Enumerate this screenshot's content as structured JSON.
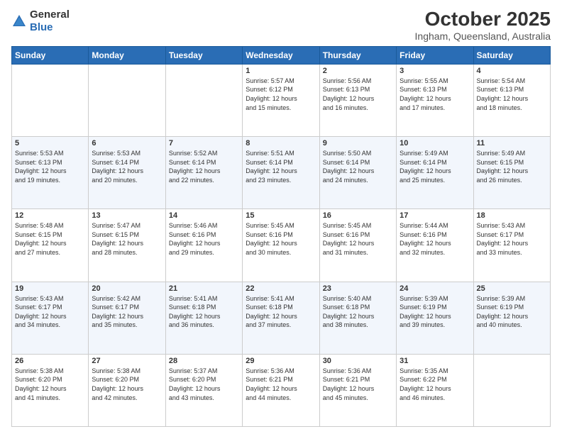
{
  "logo": {
    "general": "General",
    "blue": "Blue"
  },
  "header": {
    "title": "October 2025",
    "subtitle": "Ingham, Queensland, Australia"
  },
  "days_of_week": [
    "Sunday",
    "Monday",
    "Tuesday",
    "Wednesday",
    "Thursday",
    "Friday",
    "Saturday"
  ],
  "weeks": [
    [
      {
        "day": "",
        "info": ""
      },
      {
        "day": "",
        "info": ""
      },
      {
        "day": "",
        "info": ""
      },
      {
        "day": "1",
        "info": "Sunrise: 5:57 AM\nSunset: 6:12 PM\nDaylight: 12 hours\nand 15 minutes."
      },
      {
        "day": "2",
        "info": "Sunrise: 5:56 AM\nSunset: 6:13 PM\nDaylight: 12 hours\nand 16 minutes."
      },
      {
        "day": "3",
        "info": "Sunrise: 5:55 AM\nSunset: 6:13 PM\nDaylight: 12 hours\nand 17 minutes."
      },
      {
        "day": "4",
        "info": "Sunrise: 5:54 AM\nSunset: 6:13 PM\nDaylight: 12 hours\nand 18 minutes."
      }
    ],
    [
      {
        "day": "5",
        "info": "Sunrise: 5:53 AM\nSunset: 6:13 PM\nDaylight: 12 hours\nand 19 minutes."
      },
      {
        "day": "6",
        "info": "Sunrise: 5:53 AM\nSunset: 6:14 PM\nDaylight: 12 hours\nand 20 minutes."
      },
      {
        "day": "7",
        "info": "Sunrise: 5:52 AM\nSunset: 6:14 PM\nDaylight: 12 hours\nand 22 minutes."
      },
      {
        "day": "8",
        "info": "Sunrise: 5:51 AM\nSunset: 6:14 PM\nDaylight: 12 hours\nand 23 minutes."
      },
      {
        "day": "9",
        "info": "Sunrise: 5:50 AM\nSunset: 6:14 PM\nDaylight: 12 hours\nand 24 minutes."
      },
      {
        "day": "10",
        "info": "Sunrise: 5:49 AM\nSunset: 6:14 PM\nDaylight: 12 hours\nand 25 minutes."
      },
      {
        "day": "11",
        "info": "Sunrise: 5:49 AM\nSunset: 6:15 PM\nDaylight: 12 hours\nand 26 minutes."
      }
    ],
    [
      {
        "day": "12",
        "info": "Sunrise: 5:48 AM\nSunset: 6:15 PM\nDaylight: 12 hours\nand 27 minutes."
      },
      {
        "day": "13",
        "info": "Sunrise: 5:47 AM\nSunset: 6:15 PM\nDaylight: 12 hours\nand 28 minutes."
      },
      {
        "day": "14",
        "info": "Sunrise: 5:46 AM\nSunset: 6:16 PM\nDaylight: 12 hours\nand 29 minutes."
      },
      {
        "day": "15",
        "info": "Sunrise: 5:45 AM\nSunset: 6:16 PM\nDaylight: 12 hours\nand 30 minutes."
      },
      {
        "day": "16",
        "info": "Sunrise: 5:45 AM\nSunset: 6:16 PM\nDaylight: 12 hours\nand 31 minutes."
      },
      {
        "day": "17",
        "info": "Sunrise: 5:44 AM\nSunset: 6:16 PM\nDaylight: 12 hours\nand 32 minutes."
      },
      {
        "day": "18",
        "info": "Sunrise: 5:43 AM\nSunset: 6:17 PM\nDaylight: 12 hours\nand 33 minutes."
      }
    ],
    [
      {
        "day": "19",
        "info": "Sunrise: 5:43 AM\nSunset: 6:17 PM\nDaylight: 12 hours\nand 34 minutes."
      },
      {
        "day": "20",
        "info": "Sunrise: 5:42 AM\nSunset: 6:17 PM\nDaylight: 12 hours\nand 35 minutes."
      },
      {
        "day": "21",
        "info": "Sunrise: 5:41 AM\nSunset: 6:18 PM\nDaylight: 12 hours\nand 36 minutes."
      },
      {
        "day": "22",
        "info": "Sunrise: 5:41 AM\nSunset: 6:18 PM\nDaylight: 12 hours\nand 37 minutes."
      },
      {
        "day": "23",
        "info": "Sunrise: 5:40 AM\nSunset: 6:18 PM\nDaylight: 12 hours\nand 38 minutes."
      },
      {
        "day": "24",
        "info": "Sunrise: 5:39 AM\nSunset: 6:19 PM\nDaylight: 12 hours\nand 39 minutes."
      },
      {
        "day": "25",
        "info": "Sunrise: 5:39 AM\nSunset: 6:19 PM\nDaylight: 12 hours\nand 40 minutes."
      }
    ],
    [
      {
        "day": "26",
        "info": "Sunrise: 5:38 AM\nSunset: 6:20 PM\nDaylight: 12 hours\nand 41 minutes."
      },
      {
        "day": "27",
        "info": "Sunrise: 5:38 AM\nSunset: 6:20 PM\nDaylight: 12 hours\nand 42 minutes."
      },
      {
        "day": "28",
        "info": "Sunrise: 5:37 AM\nSunset: 6:20 PM\nDaylight: 12 hours\nand 43 minutes."
      },
      {
        "day": "29",
        "info": "Sunrise: 5:36 AM\nSunset: 6:21 PM\nDaylight: 12 hours\nand 44 minutes."
      },
      {
        "day": "30",
        "info": "Sunrise: 5:36 AM\nSunset: 6:21 PM\nDaylight: 12 hours\nand 45 minutes."
      },
      {
        "day": "31",
        "info": "Sunrise: 5:35 AM\nSunset: 6:22 PM\nDaylight: 12 hours\nand 46 minutes."
      },
      {
        "day": "",
        "info": ""
      }
    ]
  ]
}
